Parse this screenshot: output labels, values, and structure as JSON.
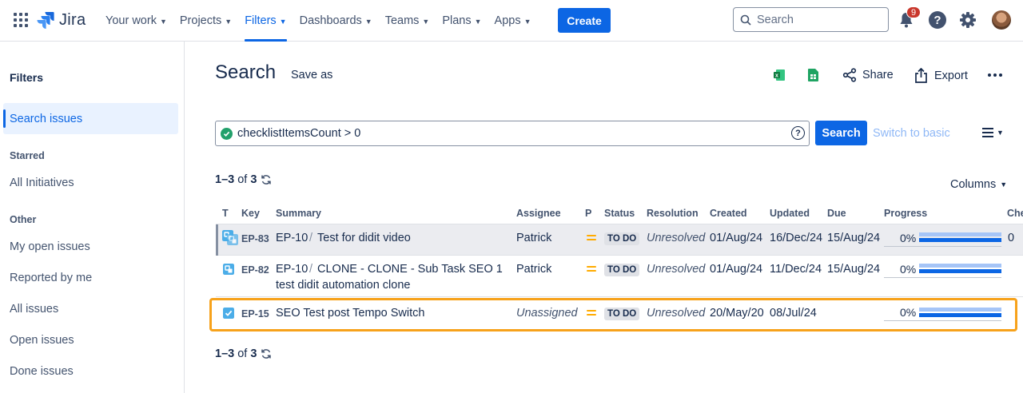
{
  "nav": {
    "logo": "Jira",
    "items": [
      {
        "label": "Your work"
      },
      {
        "label": "Projects"
      },
      {
        "label": "Filters"
      },
      {
        "label": "Dashboards"
      },
      {
        "label": "Teams"
      },
      {
        "label": "Plans"
      },
      {
        "label": "Apps"
      }
    ],
    "active": "Filters",
    "create": "Create",
    "search_placeholder": "Search",
    "notification_count": "9",
    "help": "?"
  },
  "sidebar": {
    "title": "Filters",
    "active_item": "Search issues",
    "starred_heading": "Starred",
    "starred": [
      "All Initiatives"
    ],
    "other_heading": "Other",
    "other": [
      "My open issues",
      "Reported by me",
      "All issues",
      "Open issues",
      "Done issues"
    ]
  },
  "main": {
    "title": "Search",
    "save_as": "Save as",
    "share": "Share",
    "export": "Export",
    "jql": "checklistItemsCount > 0",
    "jql_help": "?",
    "search_button": "Search",
    "switch_basic": "Switch to basic",
    "count": {
      "range": "1–3",
      "of": "of",
      "total": "3"
    },
    "columns_button": "Columns"
  },
  "table": {
    "headers": {
      "type": "T",
      "key": "Key",
      "summary": "Summary",
      "assignee": "Assignee",
      "priority": "P",
      "status": "Status",
      "resolution": "Resolution",
      "created": "Created",
      "updated": "Updated",
      "due": "Due",
      "progress": "Progress",
      "checklist": "Che"
    },
    "rows": [
      {
        "type": "subtask",
        "key": "EP-83",
        "parent": "EP-10",
        "sep": "/",
        "summary_line1": "Test for didit video",
        "summary_line2": "",
        "assignee": "Patrick",
        "status": "TO DO",
        "resolution": "Unresolved",
        "created": "01/Aug/24",
        "updated": "16/Dec/24",
        "due": "15/Aug/24",
        "progress": "0%",
        "progress_value": 0,
        "checklist": "0"
      },
      {
        "type": "subtask",
        "key": "EP-82",
        "parent": "EP-10",
        "sep": "/",
        "summary_line1": "CLONE - CLONE - Sub Task SEO 1",
        "summary_line2": "test didit automation clone",
        "assignee": "Patrick",
        "status": "TO DO",
        "resolution": "Unresolved",
        "created": "01/Aug/24",
        "updated": "11/Dec/24",
        "due": "15/Aug/24",
        "progress": "0%",
        "progress_value": 0,
        "checklist": ""
      },
      {
        "type": "task",
        "key": "EP-15",
        "parent": "",
        "sep": "",
        "summary_line1": "SEO Test post Tempo Switch",
        "summary_line2": "",
        "assignee": "Unassigned",
        "status": "TO DO",
        "resolution": "Unresolved",
        "created": "20/May/20",
        "updated": "08/Jul/24",
        "due": "",
        "progress": "0%",
        "progress_value": 0,
        "checklist": ""
      }
    ]
  },
  "colors": {
    "accent": "#0c66e4",
    "highlight": "#f7a21b",
    "priority_medium": "#ffab00",
    "badge": "#c9372c"
  },
  "icons": [
    "app-switcher-icon",
    "jira-logo-icon",
    "search-icon",
    "bell-icon",
    "help-icon",
    "gear-icon",
    "excel-icon",
    "sheets-icon",
    "share-icon",
    "export-icon",
    "more-icon",
    "refresh-icon",
    "list-view-icon"
  ]
}
